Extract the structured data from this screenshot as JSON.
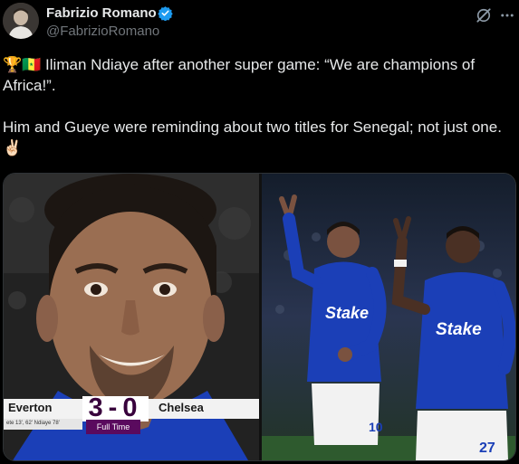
{
  "author": {
    "name": "Fabrizio Romano",
    "handle": "@FabrizioRomano",
    "verified": true
  },
  "tweet": {
    "line1": "🏆🇸🇳 Iliman Ndiaye after another super game: “We are champions of Africa!”.",
    "line2": "Him and Gueye were reminding about two titles for Senegal; not just one. ✌🏻"
  },
  "scoreboard": {
    "home": "Everton",
    "score": "3-0",
    "away": "Chelsea",
    "scorers": "ete 13', 62' Ndiaye 78'",
    "status": "Full Time"
  },
  "photo_right": {
    "shirt_sponsor": "Stake",
    "number_left": "10",
    "number_right": "27"
  },
  "colors": {
    "background": "#000000",
    "text": "#e7e9ea",
    "secondary": "#71767b",
    "verified": "#1d9bf0",
    "everton_blue": "#1b3fb7",
    "premier_purple": "#38003c"
  },
  "icons": [
    "verified-badge-icon",
    "grok-icon",
    "more-icon"
  ]
}
